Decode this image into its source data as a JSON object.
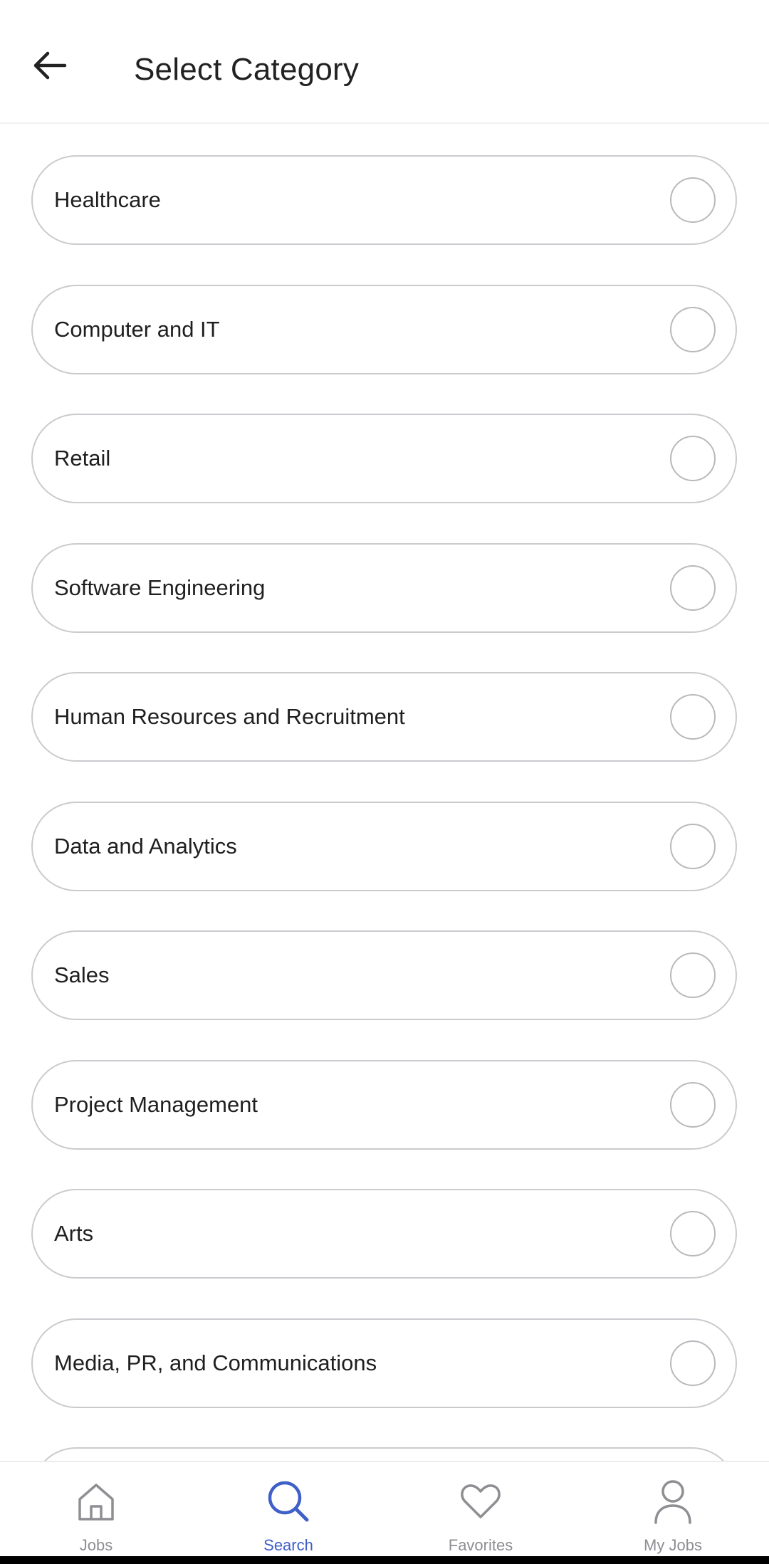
{
  "header": {
    "title": "Select Category",
    "back_icon": "arrow-left-icon"
  },
  "categories": [
    {
      "label": "Healthcare",
      "selected": false
    },
    {
      "label": "Computer and IT",
      "selected": false
    },
    {
      "label": "Retail",
      "selected": false
    },
    {
      "label": "Software Engineering",
      "selected": false
    },
    {
      "label": "Human Resources and Recruitment",
      "selected": false
    },
    {
      "label": "Data and Analytics",
      "selected": false
    },
    {
      "label": "Sales",
      "selected": false
    },
    {
      "label": "Project Management",
      "selected": false
    },
    {
      "label": "Arts",
      "selected": false
    },
    {
      "label": "Media, PR, and Communications",
      "selected": false
    },
    {
      "label": "",
      "selected": false
    }
  ],
  "bottom_nav": {
    "items": [
      {
        "label": "Jobs",
        "icon": "home-icon",
        "active": false
      },
      {
        "label": "Search",
        "icon": "search-icon",
        "active": true
      },
      {
        "label": "Favorites",
        "icon": "heart-icon",
        "active": false
      },
      {
        "label": "My Jobs",
        "icon": "person-icon",
        "active": false
      }
    ]
  },
  "colors": {
    "accent": "#3f5fc9",
    "inactive": "#8e8e93",
    "border": "#cbcbcf"
  }
}
